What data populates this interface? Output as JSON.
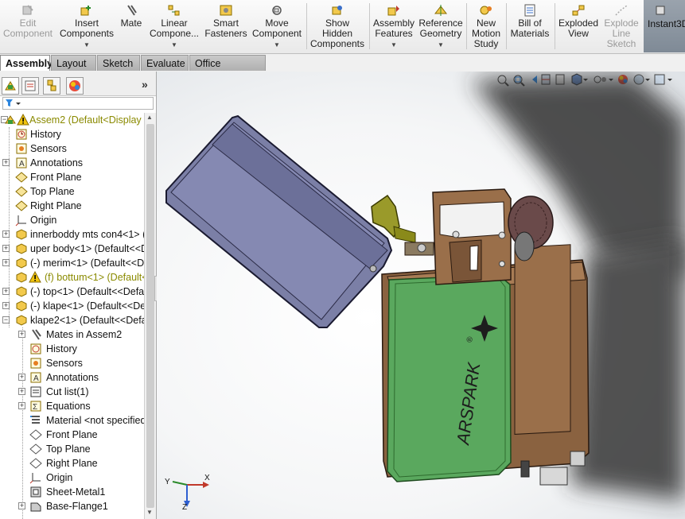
{
  "ribbon": {
    "buttons": [
      {
        "label": "Edit\nComponent",
        "enabled": false
      },
      {
        "label": "Insert\nComponents",
        "enabled": true
      },
      {
        "label": "Mate",
        "enabled": true
      },
      {
        "label": "Linear\nCompone...",
        "enabled": true
      },
      {
        "label": "Smart\nFasteners",
        "enabled": true
      },
      {
        "label": "Move\nComponent",
        "enabled": true
      },
      {
        "label": "Show\nHidden\nComponents",
        "enabled": true
      },
      {
        "label": "Assembly\nFeatures",
        "enabled": true
      },
      {
        "label": "Reference\nGeometry",
        "enabled": true
      },
      {
        "label": "New\nMotion\nStudy",
        "enabled": true
      },
      {
        "label": "Bill of\nMaterials",
        "enabled": true
      },
      {
        "label": "Exploded\nView",
        "enabled": true
      },
      {
        "label": "Explode\nLine\nSketch",
        "enabled": false
      },
      {
        "label": "Instant3D",
        "enabled": true
      }
    ]
  },
  "tabs": [
    "Assembly",
    "Layout",
    "Sketch",
    "Evaluate",
    "Office Products"
  ],
  "active_tab": "Assembly",
  "tree": [
    {
      "label": "Assem2  (Default<Display S",
      "icon": "assembly-icon",
      "warn": true
    },
    {
      "label": "History",
      "icon": "history-icon"
    },
    {
      "label": "Sensors",
      "icon": "sensor-icon"
    },
    {
      "label": "Annotations",
      "icon": "annotation-icon"
    },
    {
      "label": "Front Plane",
      "icon": "plane-icon"
    },
    {
      "label": "Top Plane",
      "icon": "plane-icon"
    },
    {
      "label": "Right Plane",
      "icon": "plane-icon"
    },
    {
      "label": "Origin",
      "icon": "origin-icon"
    },
    {
      "label": "innerboddy mts con4<1> (",
      "icon": "part-icon"
    },
    {
      "label": "uper body<1> (Default<<D",
      "icon": "part-icon"
    },
    {
      "label": "(-) merim<1> (Default<<D",
      "icon": "part-icon"
    },
    {
      "label": "(f) bottum<1> (Default<",
      "icon": "part-icon",
      "warn": true
    },
    {
      "label": "(-) top<1> (Default<<Defa",
      "icon": "part-icon"
    },
    {
      "label": "(-) klape<1> (Default<<De",
      "icon": "part-icon"
    },
    {
      "label": "klape2<1> (Default<<Defa",
      "icon": "part-icon"
    },
    {
      "label": "Mates in Assem2",
      "icon": "mates-icon"
    },
    {
      "label": "History",
      "icon": "history-icon"
    },
    {
      "label": "Sensors",
      "icon": "sensor-icon"
    },
    {
      "label": "Annotations",
      "icon": "annotation-icon"
    },
    {
      "label": "Cut list(1)",
      "icon": "cutlist-icon"
    },
    {
      "label": "Equations",
      "icon": "equation-icon"
    },
    {
      "label": "Material <not specified",
      "icon": "material-icon"
    },
    {
      "label": "Front Plane",
      "icon": "plane-icon"
    },
    {
      "label": "Top Plane",
      "icon": "plane-icon"
    },
    {
      "label": "Right Plane",
      "icon": "plane-icon"
    },
    {
      "label": "Origin",
      "icon": "origin-icon"
    },
    {
      "label": "Sheet-Metal1",
      "icon": "sheetmetal-icon"
    },
    {
      "label": "Base-Flange1",
      "icon": "flange-icon"
    }
  ],
  "model": {
    "brand_text": "ARSPARK",
    "brand_mark": "®"
  },
  "triad": {
    "x": "X",
    "y": "Y",
    "z": "Z"
  },
  "colors": {
    "lid": "#7b7fa6",
    "body": "#8a6240",
    "label": "#5aa85e",
    "lever": "#9a9a2a",
    "wheel": "#6a4a4a"
  }
}
